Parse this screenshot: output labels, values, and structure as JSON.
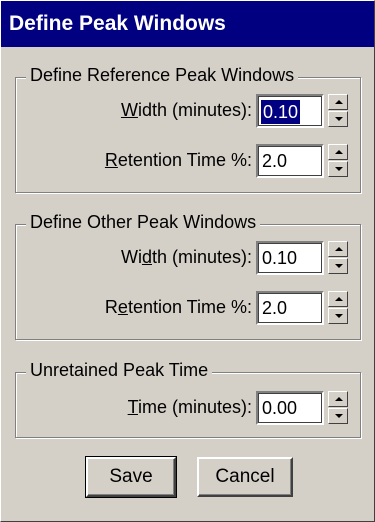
{
  "window": {
    "title": "Define Peak Windows"
  },
  "reference_group": {
    "legend": "Define Reference Peak Windows",
    "width": {
      "label_pre": "",
      "label_key": "W",
      "label_post": "idth (minutes):",
      "value": "0.10"
    },
    "retention": {
      "label_pre": "",
      "label_key": "R",
      "label_post": "etention Time %:",
      "value": "2.0"
    }
  },
  "other_group": {
    "legend": "Define Other Peak Windows",
    "width": {
      "label_pre": "Wi",
      "label_key": "d",
      "label_post": "th (minutes):",
      "value": "0.10"
    },
    "retention": {
      "label_pre": "R",
      "label_key": "e",
      "label_post": "tention Time %:",
      "value": "2.0"
    }
  },
  "unretained_group": {
    "legend": "Unretained Peak Time",
    "time": {
      "label_pre": "",
      "label_key": "T",
      "label_post": "ime (minutes):",
      "value": "0.00"
    }
  },
  "buttons": {
    "save": "Save",
    "cancel": "Cancel"
  },
  "icons": {
    "spin_up": "arrow-up-icon",
    "spin_down": "arrow-down-icon"
  }
}
